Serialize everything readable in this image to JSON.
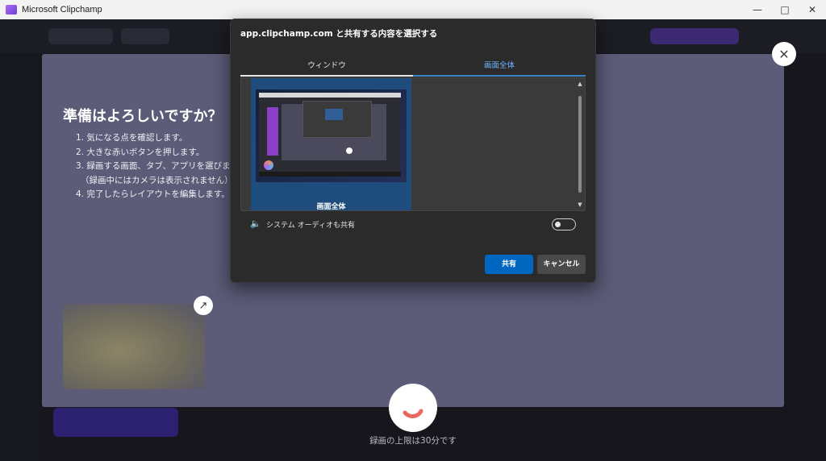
{
  "window": {
    "title": "Microsoft Clipchamp",
    "minimize_icon": "minimize-icon",
    "maximize_icon": "maximize-icon",
    "close_icon": "close-icon"
  },
  "recorder": {
    "heading": "準備はよろしいですか？",
    "steps": [
      "1. 気になる点を確認します。",
      "2. 大きな赤いボタンを押します。",
      "3. 録画する画面、タブ、アプリを選びます。",
      "（録画中にはカメラは表示されません）",
      "4. 完了したらレイアウトを編集します。"
    ],
    "limit_text": "録画の上限は30分です",
    "record_button_color": "#e8685f"
  },
  "share_dialog": {
    "title": "app.clipchamp.com と共有する内容を選択する",
    "tabs": [
      {
        "label": "ウィンドウ",
        "selected": false
      },
      {
        "label": "画面全体",
        "selected": true
      }
    ],
    "screen_option_label": "画面全体",
    "audio_label": "システム オーディオも共有",
    "audio_enabled": false,
    "share_button": "共有",
    "cancel_button": "キャンセル",
    "accent_color": "#0067c0"
  }
}
